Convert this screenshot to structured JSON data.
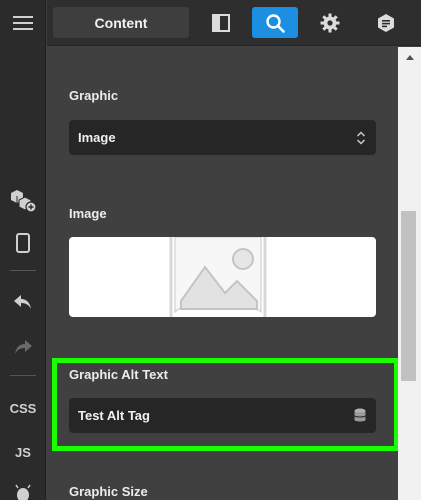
{
  "topbar": {
    "content_tab": "Content"
  },
  "rail": {
    "css_label": "CSS",
    "js_label": "JS"
  },
  "panel": {
    "graphic_label": "Graphic",
    "graphic_value": "Image",
    "image_label": "Image",
    "alt_label": "Graphic Alt Text",
    "alt_value": "Test Alt Tag",
    "size_label": "Graphic Size"
  },
  "icons": {
    "menu": "hamburger-menu-icon",
    "layout": "panel-layout-icon",
    "search": "search-icon",
    "settings": "gear-icon",
    "info": "hexagon-doc-icon",
    "add_component": "cubes-add-icon",
    "device": "mobile-device-icon",
    "undo": "undo-icon",
    "redo": "redo-icon",
    "dynamic": "database-icon",
    "select": "chevron-up-down-icon",
    "placeholder": "image-placeholder-icon"
  },
  "colors": {
    "accent": "#1d8fe3",
    "highlight": "#1aff00",
    "panel_bg": "#404040",
    "field_bg": "#262626"
  }
}
